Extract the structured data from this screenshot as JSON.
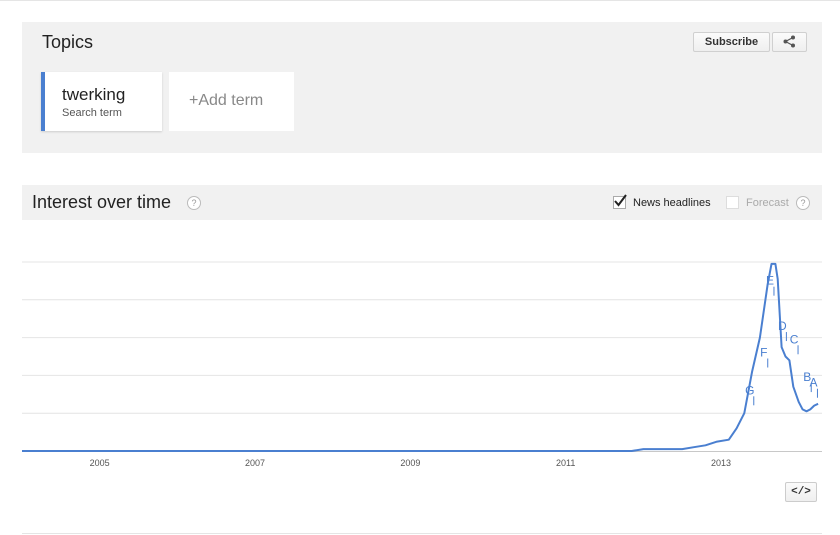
{
  "topics": {
    "title": "Topics",
    "subscribe_label": "Subscribe",
    "share_icon": "share-icon",
    "terms": [
      {
        "name": "twerking",
        "type": "Search term",
        "color": "#4a7fd0"
      }
    ],
    "add_term_label": "+Add term"
  },
  "interest": {
    "title": "Interest over time",
    "help_icon": "?",
    "news_headlines_label": "News headlines",
    "news_headlines_checked": true,
    "forecast_label": "Forecast",
    "forecast_checked": false,
    "embed_label": "</>"
  },
  "chart_data": {
    "type": "line",
    "title": "",
    "xlabel": "",
    "ylabel": "",
    "grid": true,
    "xlim": [
      2004.0,
      2014.3
    ],
    "ylim": [
      0,
      100
    ],
    "x_ticks": [
      "2005",
      "2007",
      "2009",
      "2011",
      "2013"
    ],
    "series": [
      {
        "color": "#4a7fd0",
        "x": [
          2004.0,
          2011.85,
          2012.0,
          2012.5,
          2012.65,
          2012.8,
          2012.95,
          2013.1,
          2013.2,
          2013.3,
          2013.4,
          2013.5,
          2013.6,
          2013.65,
          2013.7,
          2013.73,
          2013.78,
          2013.83,
          2013.88,
          2013.93,
          2014.0,
          2014.05,
          2014.1,
          2014.15,
          2014.2,
          2014.25
        ],
        "y": [
          0,
          0,
          1,
          1,
          2,
          3,
          5,
          6,
          12,
          20,
          42,
          60,
          88,
          99,
          99,
          91,
          55,
          50,
          48,
          34,
          26,
          22,
          21,
          22,
          24,
          25
        ]
      }
    ],
    "annotations": [
      {
        "label": "G",
        "x": 2013.37,
        "y": 30
      },
      {
        "label": "F",
        "x": 2013.55,
        "y": 50
      },
      {
        "label": "E",
        "x": 2013.63,
        "y": 88
      },
      {
        "label": "D",
        "x": 2013.79,
        "y": 64
      },
      {
        "label": "C",
        "x": 2013.94,
        "y": 57
      },
      {
        "label": "B",
        "x": 2014.11,
        "y": 37
      },
      {
        "label": "A",
        "x": 2014.19,
        "y": 34
      }
    ]
  }
}
